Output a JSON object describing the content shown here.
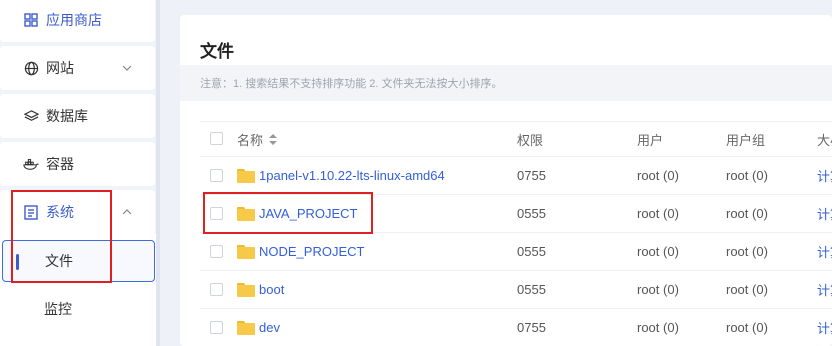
{
  "sidebar": {
    "items": [
      {
        "label": "应用商店",
        "icon": "grid-icon"
      },
      {
        "label": "网站",
        "icon": "globe-icon"
      },
      {
        "label": "数据库",
        "icon": "database-layers-icon"
      },
      {
        "label": "容器",
        "icon": "docker-icon"
      },
      {
        "label": "系统",
        "icon": "system-icon"
      }
    ],
    "submenu": [
      {
        "label": "文件",
        "active": true
      },
      {
        "label": "监控",
        "active": false
      }
    ]
  },
  "main": {
    "title": "文件",
    "notice": "注意：1. 搜索结果不支持排序功能 2. 文件夹无法按大小排序。",
    "columns": [
      "名称",
      "权限",
      "用户",
      "用户组",
      "大小"
    ],
    "rows": [
      {
        "name": "1panel-v1.10.22-lts-linux-amd64",
        "perm": "0755",
        "user": "root (0)",
        "group": "root (0)",
        "size": "计算"
      },
      {
        "name": "JAVA_PROJECT",
        "perm": "0555",
        "user": "root (0)",
        "group": "root (0)",
        "size": "计算"
      },
      {
        "name": "NODE_PROJECT",
        "perm": "0555",
        "user": "root (0)",
        "group": "root (0)",
        "size": "计算"
      },
      {
        "name": "boot",
        "perm": "0555",
        "user": "root (0)",
        "group": "root (0)",
        "size": "计算"
      },
      {
        "name": "dev",
        "perm": "0755",
        "user": "root (0)",
        "group": "root (0)",
        "size": "计算"
      }
    ]
  },
  "colors": {
    "accent": "#3d5ccc",
    "link": "#3360d9",
    "highlight": "#e02020",
    "folder": "#f7c948"
  }
}
